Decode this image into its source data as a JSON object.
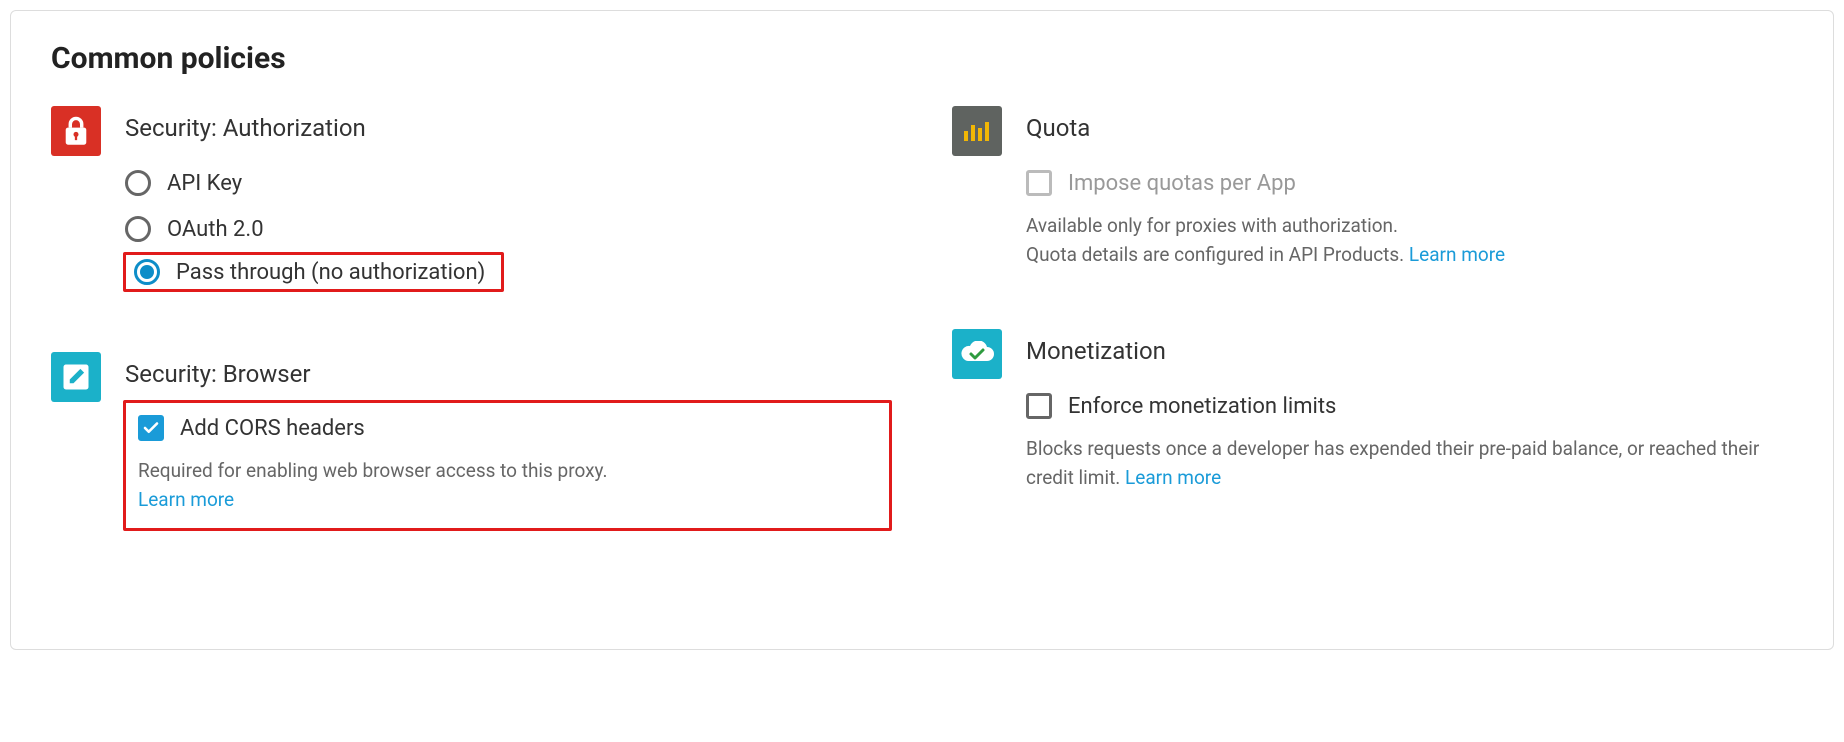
{
  "title": "Common policies",
  "security_auth": {
    "icon": "lock-icon",
    "heading": "Security: Authorization",
    "options": {
      "api_key": "API Key",
      "oauth": "OAuth 2.0",
      "pass_through": "Pass through (no authorization)"
    },
    "selected": "pass_through"
  },
  "quota": {
    "icon": "bars-icon",
    "heading": "Quota",
    "checkbox_label": "Impose quotas per App",
    "checked": false,
    "disabled": true,
    "help_line1": "Available only for proxies with authorization.",
    "help_line2": "Quota details are configured in API Products.",
    "learn_more": "Learn more"
  },
  "security_browser": {
    "icon": "pencil-icon",
    "heading": "Security: Browser",
    "checkbox_label": "Add CORS headers",
    "checked": true,
    "help": "Required for enabling web browser access to this proxy.",
    "learn_more": "Learn more"
  },
  "monetization": {
    "icon": "cloud-check-icon",
    "heading": "Monetization",
    "checkbox_label": "Enforce monetization limits",
    "checked": false,
    "help": "Blocks requests once a developer has expended their pre-paid balance, or reached their credit limit.",
    "learn_more": "Learn more"
  }
}
